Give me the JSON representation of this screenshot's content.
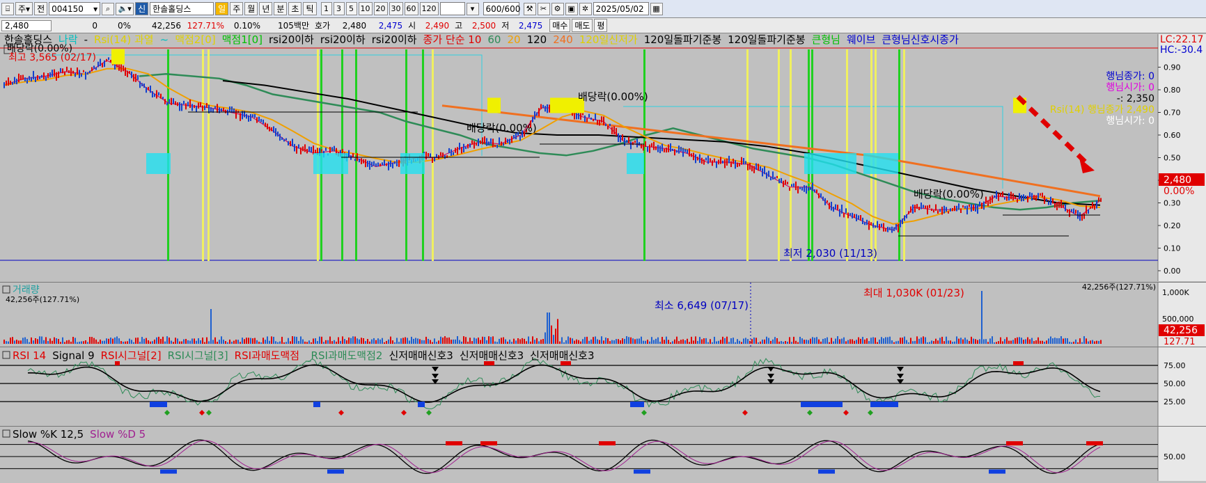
{
  "toolbar": {
    "period_type": "주",
    "prev_label": "전",
    "code": "004150",
    "new_label": "신",
    "stock_name": "한솔홀딩스",
    "periods": [
      "일",
      "주",
      "월",
      "년",
      "분",
      "초",
      "틱"
    ],
    "active_period": "일",
    "minute_options": [
      "1",
      "3",
      "5",
      "10",
      "20",
      "30",
      "60",
      "120"
    ],
    "count_value": "600",
    "count_total": "/600",
    "date": "2025/05/02"
  },
  "quote": {
    "price": "2,480",
    "change": "0",
    "change_pct": "0%",
    "volume": "42,256",
    "vol_ratio": "127.71%",
    "turnover": "0.10%",
    "amount": "105백만",
    "hoga_label": "호가",
    "hoga": "2,480",
    "hoga2": "2,475",
    "open_label": "시",
    "open": "2,490",
    "high_label": "고",
    "high": "2,500",
    "low_label": "저",
    "low": "2,475",
    "buy_label": "매수",
    "sell_label": "매도",
    "last_label": "평"
  },
  "price_panel": {
    "legend": [
      {
        "text": "한솔홀딩스",
        "color": "#000000"
      },
      {
        "text": "나락",
        "color": "#00c0c0"
      },
      {
        "text": "-",
        "color": "#000000"
      },
      {
        "text": "Rsi(14) 과열",
        "color": "#e0d000"
      },
      {
        "text": "~",
        "color": "#00c0c0"
      },
      {
        "text": "맥점2[0]",
        "color": "#e0d000"
      },
      {
        "text": "맥점1[0]",
        "color": "#00c000"
      },
      {
        "text": "rsi20이하",
        "color": "#000000"
      },
      {
        "text": "rsi20이하",
        "color": "#000000"
      },
      {
        "text": "rsi20이하",
        "color": "#000000"
      },
      {
        "text": "종가 단순 10",
        "color": "#e00000"
      },
      {
        "text": "60",
        "color": "#2e8b57"
      },
      {
        "text": "20",
        "color": "#f0a000"
      },
      {
        "text": "120",
        "color": "#000000"
      },
      {
        "text": "240",
        "color": "#f07020"
      },
      {
        "text": "120일신저가",
        "color": "#e0d000"
      },
      {
        "text": "120일돌파기준봉",
        "color": "#000000"
      },
      {
        "text": "120일돌파기준봉",
        "color": "#000000"
      },
      {
        "text": "큰형님",
        "color": "#00c000"
      },
      {
        "text": "웨이브",
        "color": "#0000d0"
      },
      {
        "text": "큰형님신호시종가",
        "color": "#0000d0"
      }
    ],
    "sub_label": "배당락(0.00%)",
    "max_label": "최고 3,565 (02/17)",
    "min_label": "최저 2,030 (11/13)",
    "dividend_label": "배당락(0.00%)",
    "right_top1": "LC:22.17",
    "right_top2": "HC:-30.4",
    "y_ticks": [
      "0.90",
      "0.80",
      "0.70",
      "0.60",
      "0.50",
      "0.40",
      "0.30",
      "0.20",
      "0.10",
      "0.00"
    ],
    "price_box": "2,480",
    "pct_box": "0.00%",
    "info_lines": [
      {
        "text": "행님종가: 0",
        "color": "#0000d0"
      },
      {
        "text": "행님시가: 0",
        "color": "#e000e0"
      },
      {
        "text": "-: 2,350",
        "color": "#000000"
      },
      {
        "text": "Rsi(14) 행님종가 2,490",
        "color": "#e0d000"
      },
      {
        "text": "행님시가: 0",
        "color": "#ffffff"
      }
    ]
  },
  "volume_panel": {
    "title": "거래량",
    "sub": "42,256주(127.71%)",
    "min_label": "최소 6,649 (07/17)",
    "max_label": "최대 1,030K (01/23)",
    "right_label": "42,256주(127.71%)",
    "y_ticks": [
      "1,000K",
      "500,000"
    ],
    "box_value": "42,256",
    "box_pct": "127.71"
  },
  "rsi_panel": {
    "legend": [
      {
        "text": "RSI 14",
        "color": "#e00000"
      },
      {
        "text": "Signal 9",
        "color": "#000000"
      },
      {
        "text": "RSI시그널[2]",
        "color": "#e00000"
      },
      {
        "text": "RSI시그널[3]",
        "color": "#2e8b57"
      },
      {
        "text": "RSI과매도맥점",
        "color": "#e00000"
      },
      {
        "text": "_RSI과매도맥점2",
        "color": "#2e8b57"
      },
      {
        "text": "신저매매신호3",
        "color": "#000000"
      },
      {
        "text": "신저매매신호3",
        "color": "#000000"
      },
      {
        "text": "신저매매신호3",
        "color": "#000000"
      }
    ],
    "y_ticks": [
      "75.00",
      "50.00",
      "25.00"
    ]
  },
  "stoch_panel": {
    "legend": [
      {
        "text": "Slow %K 12,5",
        "color": "#000000"
      },
      {
        "text": "Slow %D 5",
        "color": "#a02090"
      }
    ],
    "y_ticks": [
      "50.00"
    ]
  },
  "chart_data": {
    "type": "line",
    "title": "한솔홀딩스",
    "xlabel": "",
    "ylabel": "",
    "y_axis_ticks": [
      "0.00",
      "0.10",
      "0.20",
      "0.30",
      "0.40",
      "0.50",
      "0.60",
      "0.70",
      "0.80",
      "0.90"
    ],
    "series": [
      {
        "name": "한솔홀딩스",
        "values": [
          0.82,
          0.85,
          0.86,
          0.88,
          0.87,
          0.93,
          0.88,
          0.8,
          0.74,
          0.73,
          0.72,
          0.7,
          0.68,
          0.62,
          0.55,
          0.52,
          0.53,
          0.5,
          0.46,
          0.48,
          0.5,
          0.5,
          0.54,
          0.57,
          0.56,
          0.6,
          0.72,
          0.72,
          0.68,
          0.66,
          0.57,
          0.55,
          0.54,
          0.52,
          0.48,
          0.48,
          0.47,
          0.42,
          0.37,
          0.37,
          0.28,
          0.24,
          0.2,
          0.18,
          0.28,
          0.27,
          0.27,
          0.28,
          0.33,
          0.32,
          0.33,
          0.29,
          0.24,
          0.31
        ]
      },
      {
        "name": "60",
        "values": [
          0.86,
          0.87,
          0.86,
          0.85,
          0.82,
          0.78,
          0.76,
          0.74,
          0.72,
          0.7,
          0.66,
          0.63,
          0.6,
          0.56,
          0.54,
          0.52,
          0.51,
          0.53,
          0.56,
          0.6,
          0.63,
          0.6,
          0.57,
          0.54,
          0.52,
          0.5,
          0.47,
          0.43,
          0.39,
          0.35,
          0.32,
          0.3,
          0.28,
          0.27,
          0.28,
          0.3,
          0.31
        ]
      },
      {
        "name": "120",
        "values": [
          0.84,
          0.82,
          0.79,
          0.76,
          0.72,
          0.68,
          0.64,
          0.61,
          0.6,
          0.6,
          0.59,
          0.58,
          0.57,
          0.55,
          0.52,
          0.48,
          0.44,
          0.4,
          0.36,
          0.33,
          0.3,
          0.29
        ]
      },
      {
        "name": "240",
        "values": [
          0.73,
          0.71,
          0.69,
          0.67,
          0.65,
          0.63,
          0.61,
          0.59,
          0.57,
          0.55,
          0.53,
          0.51,
          0.48,
          0.45,
          0.42,
          0.39,
          0.36,
          0.33
        ]
      }
    ],
    "volume": {
      "min": "최소 6,649 (07/17)",
      "max": "최대 1,030K (01/23)"
    },
    "rsi": {
      "ylim": [
        0,
        100
      ],
      "levels": [
        75,
        50,
        25
      ]
    },
    "stoch": {
      "levels": [
        50
      ]
    }
  }
}
